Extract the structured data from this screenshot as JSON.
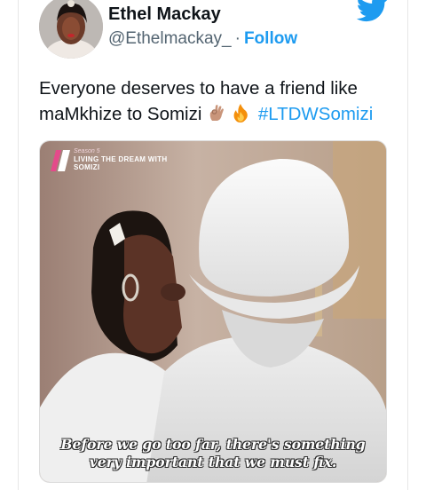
{
  "tweet": {
    "author_name": "Ethel Mackay",
    "handle": "@Ethelmackay_",
    "separator": "·",
    "follow_label": "Follow",
    "text_line1": "Everyone deserves to have a friend like",
    "text_line2_prefix": "maMkhize to Somizi",
    "hashtag": "#LTDWSomizi",
    "emojis": [
      "ok-hand-icon",
      "fire-icon"
    ],
    "accent_color": "#1d9bf0"
  },
  "media": {
    "show_badge_season": "Season 5",
    "show_badge_title": "LIVING THE DREAM WITH SOMIZI",
    "subtitle_line1": "Before we go too far, there's something",
    "subtitle_line2": "very important that we must fix."
  },
  "icons": {
    "brand": "twitter-bird-icon"
  }
}
